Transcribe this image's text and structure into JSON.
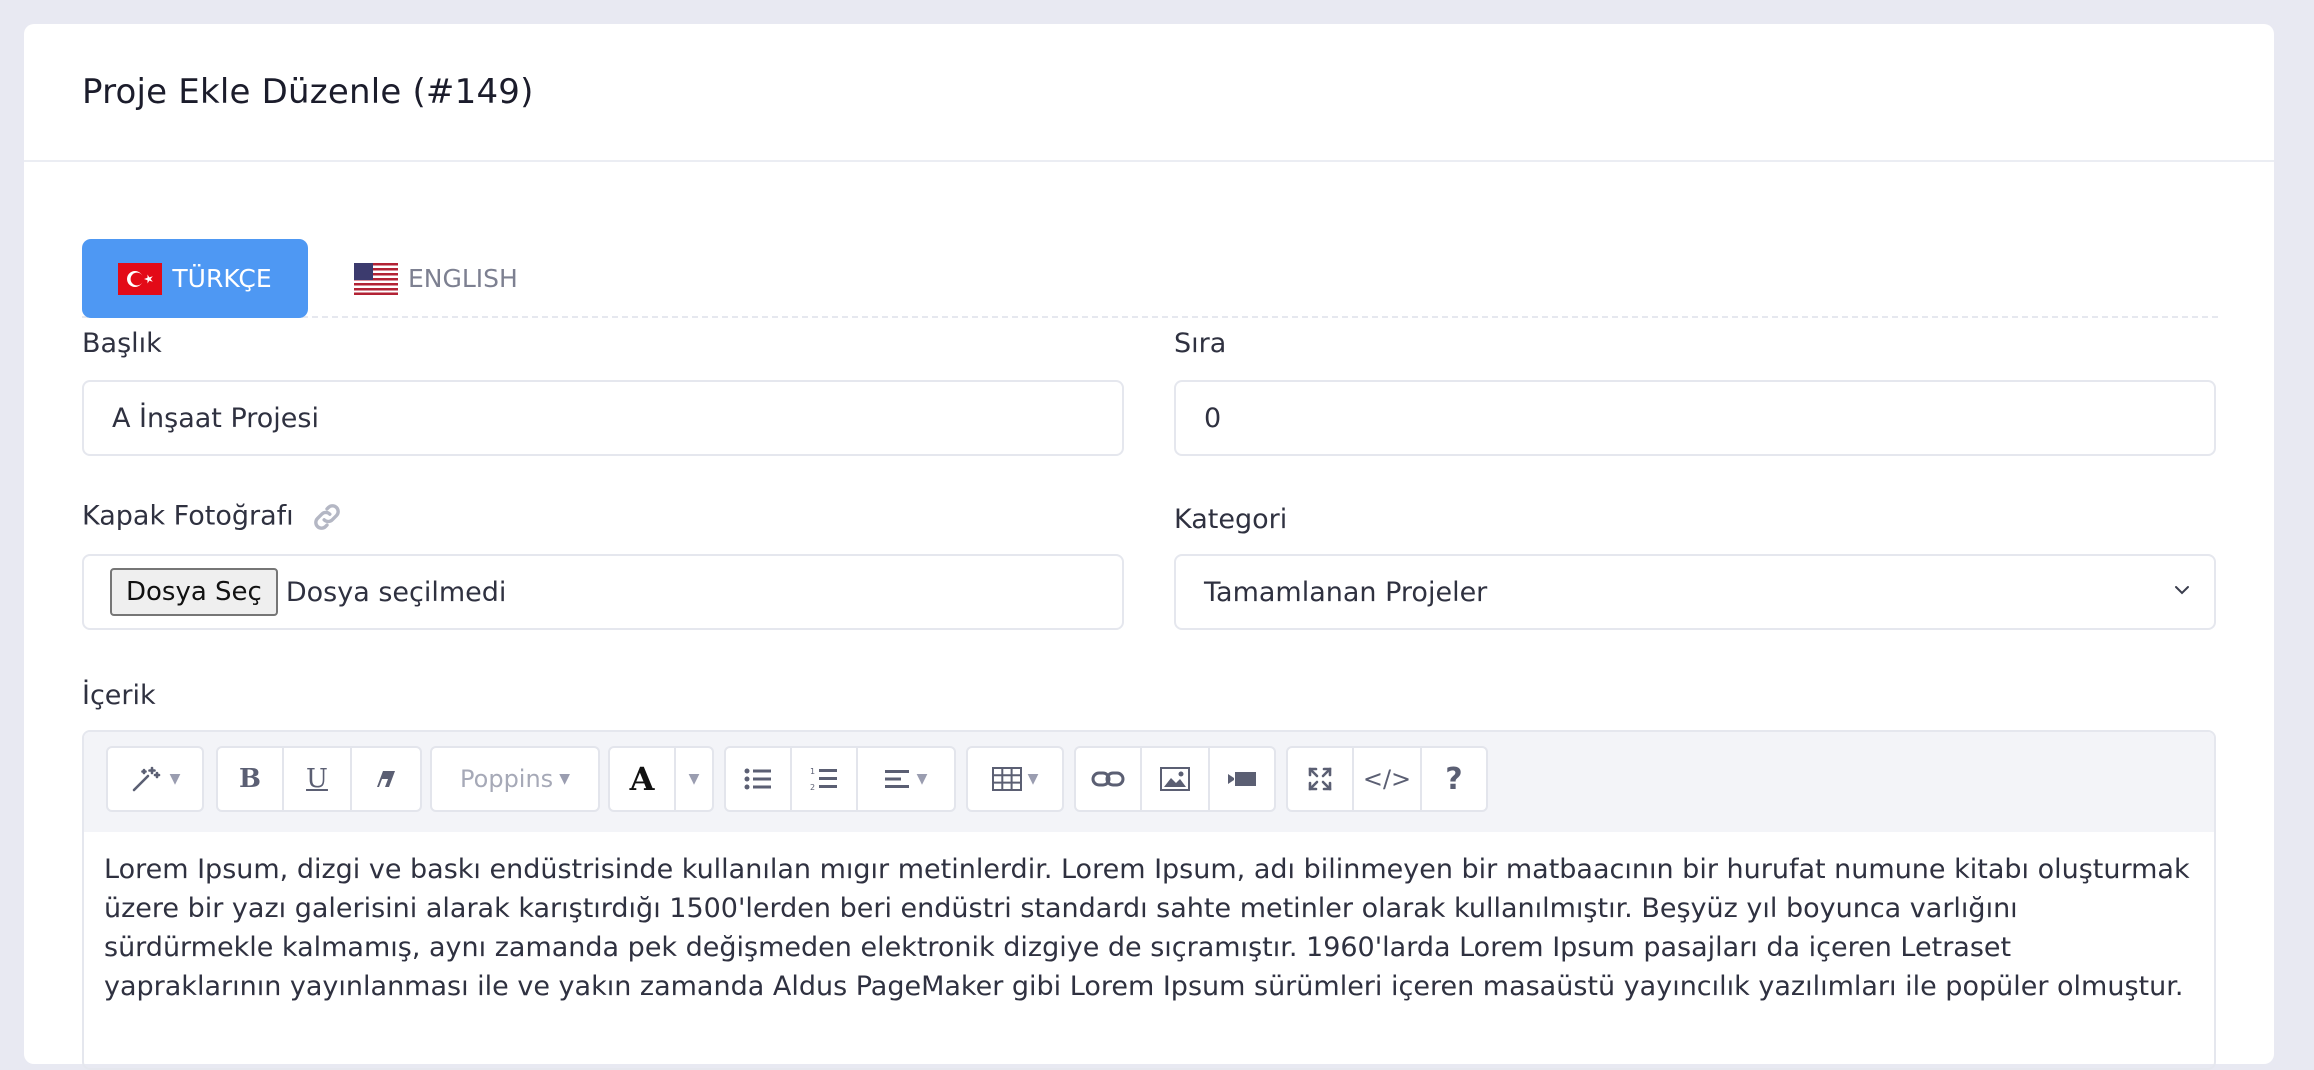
{
  "header": {
    "title": "Proje Ekle Düzenle (#149)"
  },
  "tabs": [
    {
      "label": "TÜRKÇE",
      "flag": "turkey-flag",
      "active": true
    },
    {
      "label": "ENGLISH",
      "flag": "usa-flag",
      "active": false
    }
  ],
  "form": {
    "baslik": {
      "label": "Başlık",
      "value": "A İnşaat Projesi"
    },
    "sira": {
      "label": "Sıra",
      "value": "0"
    },
    "kapak": {
      "label": "Kapak Fotoğrafı",
      "button": "Dosya Seç",
      "status": "Dosya seçilmedi"
    },
    "kategori": {
      "label": "Kategori",
      "selected": "Tamamlanan Projeler"
    },
    "icerik": {
      "label": "İçerik",
      "font": "Poppins",
      "text": "Lorem Ipsum, dizgi ve baskı endüstrisinde kullanılan mıgır metinlerdir. Lorem Ipsum, adı bilinmeyen bir matbaacının bir hurufat numune kitabı oluşturmak üzere bir yazı galerisini alarak karıştırdığı 1500'lerden beri endüstri standardı sahte metinler olarak kullanılmıştır. Beşyüz yıl boyunca varlığını sürdürmekle kalmamış, aynı zamanda pek değişmeden elektronik dizgiye de sıçramıştır. 1960'larda Lorem Ipsum pasajları da içeren Letraset yapraklarının yayınlanması ile ve yakın zamanda Aldus PageMaker gibi Lorem Ipsum sürümleri içeren masaüstü yayıncılık yazılımları ile popüler olmuştur."
    }
  },
  "colors": {
    "accent": "#4e98f3",
    "background": "#e8e9f2"
  }
}
